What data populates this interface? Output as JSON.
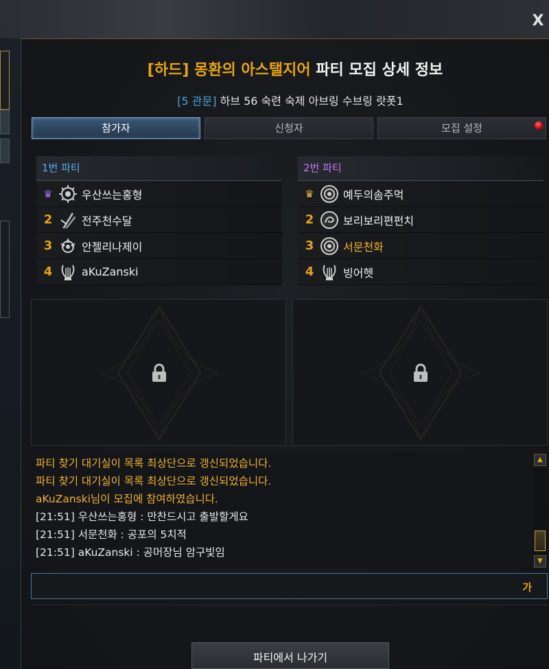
{
  "window": {
    "close_label": "X",
    "title_prefix": "[하드] 몽환의 아스탤지어",
    "title_suffix": "파티 모집 상세 정보",
    "subtitle_prefix": "[5 관문]",
    "subtitle_text": "하브 56 숙련 숙제 아브링 수브링 랏폿1"
  },
  "tabs": [
    {
      "label": "참가자",
      "active": true
    },
    {
      "label": "신청자",
      "active": false
    },
    {
      "label": "모집 설정",
      "active": false,
      "notification": true
    }
  ],
  "parties": [
    {
      "name": "1번 파티",
      "members": [
        {
          "slot": "leader-crown",
          "name": "우산쓰는홍형",
          "class_icon": "sun-emblem-icon"
        },
        {
          "slot": "2",
          "name": "전주천수달",
          "class_icon": "blade-emblem-icon"
        },
        {
          "slot": "3",
          "name": "안젤리나제이",
          "class_icon": "sun-emblem-icon"
        },
        {
          "slot": "4",
          "name": "aKuZanski",
          "class_icon": "lyre-icon"
        }
      ]
    },
    {
      "name": "2번 파티",
      "members": [
        {
          "slot": "leader-crown",
          "name": "예두의솜주먹",
          "class_icon": "round-emblem-icon"
        },
        {
          "slot": "2",
          "name": "보리보리편펀치",
          "class_icon": "round-emblem-icon"
        },
        {
          "slot": "3",
          "name": "서문천화",
          "class_icon": "round-emblem-icon",
          "highlight": true
        },
        {
          "slot": "4",
          "name": "빙어헷",
          "class_icon": "lyre-icon"
        }
      ]
    }
  ],
  "chat": {
    "lines": [
      {
        "type": "system",
        "text": "파티 찾기 대기실이 목록 최상단으로 갱신되었습니다."
      },
      {
        "type": "system",
        "text": "파티 찾기 대기실이 목록 최상단으로 갱신되었습니다."
      },
      {
        "type": "system",
        "text": "aKuZanski님이 모집에 참여하였습니다."
      },
      {
        "type": "message",
        "text": "[21:51] 우산쓰는홍형 : 만찬드시고 출발할게요"
      },
      {
        "type": "message",
        "text": "[21:51] 서문천화 : 공포의 5치적"
      },
      {
        "type": "message",
        "text": "[21:51] aKuZanski : 공머장님 암구빛임"
      }
    ],
    "input_value": "",
    "ime_indicator": "가"
  },
  "actions": {
    "leave_label": "파티에서 나가기"
  },
  "colors": {
    "accent_gold": "#e8a317",
    "party1": "#5aaaf0",
    "party2": "#c278f0",
    "subtitle_accent": "#4aa3df"
  }
}
